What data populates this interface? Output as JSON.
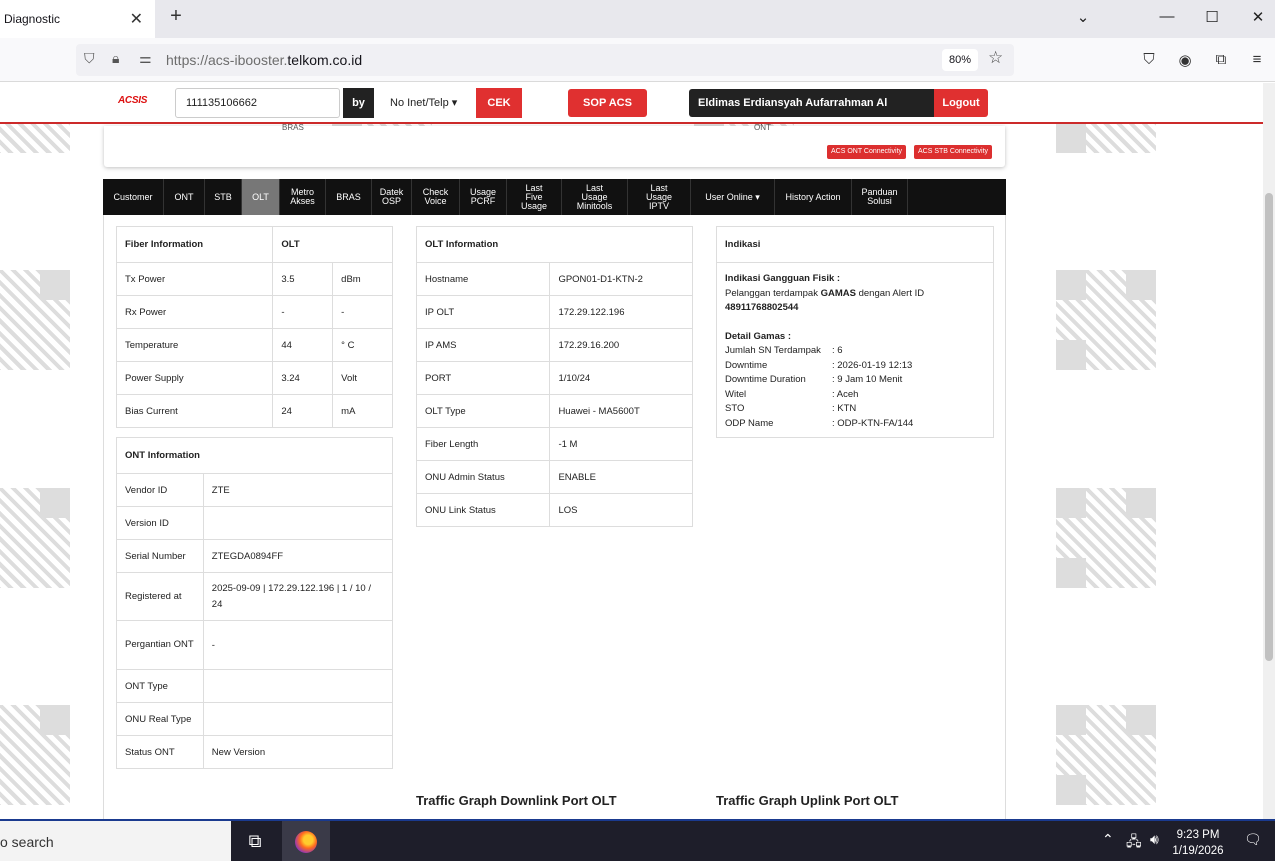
{
  "browser": {
    "tab_title": "Diagnostic",
    "url_prefix": "https://acs-ibooster.",
    "url_domain": "telkom.co.id",
    "zoom": "80%"
  },
  "header": {
    "logo": "ACSIS",
    "search_value": "111135106662",
    "by_label": "by",
    "select_value": "No Inet/Telp",
    "cek_label": "CEK",
    "sop_label": "SOP ACS",
    "user_name": "Eldimas Erdiansyah Aufarrahman Al Mubarok",
    "logout_label": "Logout",
    "cut_label_1": "BRAS",
    "cut_label_2": "ONT",
    "ont_conn_btn": "ACS ONT Connectivity",
    "stb_conn_btn": "ACS STB Connectivity"
  },
  "menu": [
    {
      "label": "Customer"
    },
    {
      "label": "ONT"
    },
    {
      "label": "STB"
    },
    {
      "label": "OLT",
      "active": true
    },
    {
      "label": "Metro Akses"
    },
    {
      "label": "BRAS"
    },
    {
      "label": "Datek OSP"
    },
    {
      "label": "Check Voice"
    },
    {
      "label": "Usage PCRF"
    },
    {
      "label": "Last Five Usage"
    },
    {
      "label": "Last Usage Minitools"
    },
    {
      "label": "Last Usage IPTV"
    },
    {
      "label": "User Online ▾"
    },
    {
      "label": "History Action"
    },
    {
      "label": "Panduan Solusi"
    }
  ],
  "fiber": {
    "header": [
      "Fiber Information",
      "OLT"
    ],
    "rows": [
      [
        "Tx Power",
        "3.5",
        "dBm"
      ],
      [
        "Rx Power",
        "-",
        "-"
      ],
      [
        "Temperature",
        "44",
        "° C"
      ],
      [
        "Power Supply",
        "3.24",
        "Volt"
      ],
      [
        "Bias Current",
        "24",
        "mA"
      ]
    ]
  },
  "ont": {
    "header": "ONT Information",
    "rows": [
      [
        "Vendor ID",
        "ZTE"
      ],
      [
        "Version ID",
        ""
      ],
      [
        "Serial Number",
        "ZTEGDA0894FF"
      ],
      [
        "Registered at",
        "2025-09-09 | 172.29.122.196 | 1 / 10 / 24"
      ],
      [
        "Pergantian ONT",
        "-"
      ],
      [
        "ONT Type",
        ""
      ],
      [
        "ONU Real Type",
        ""
      ],
      [
        "Status ONT",
        "New Version"
      ]
    ]
  },
  "olt": {
    "header": "OLT Information",
    "rows": [
      [
        "Hostname",
        "GPON01-D1-KTN-2"
      ],
      [
        "IP OLT",
        "172.29.122.196"
      ],
      [
        "IP AMS",
        "172.29.16.200"
      ],
      [
        "PORT",
        "1/10/24"
      ],
      [
        "OLT Type",
        "Huawei - MA5600T"
      ],
      [
        "Fiber Length",
        "-1 M"
      ],
      [
        "ONU Admin Status",
        "ENABLE"
      ],
      [
        "ONU Link Status",
        "LOS"
      ]
    ]
  },
  "indikasi": {
    "header": "Indikasi",
    "gangguan_title": "Indikasi Gangguan Fisik :",
    "gangguan_pre": "Pelanggan terdampak ",
    "gangguan_bold": "GAMAS",
    "gangguan_post": " dengan Alert ID",
    "alert_id": "48911768802544",
    "detail_title": "Detail Gamas :",
    "details": [
      [
        "Jumlah SN Terdampak",
        ": 6"
      ],
      [
        "Downtime",
        ": 2026-01-19 12:13"
      ],
      [
        "Downtime Duration",
        ": 9 Jam 10 Menit"
      ],
      [
        "Witel",
        ": Aceh"
      ],
      [
        "STO",
        ": KTN"
      ],
      [
        "ODP Name",
        ": ODP-KTN-FA/144"
      ]
    ]
  },
  "graphs": {
    "downlink": "Traffic Graph Downlink Port OLT",
    "uplink": "Traffic Graph Uplink Port OLT"
  },
  "taskbar": {
    "search": "o search",
    "time": "9:23 PM",
    "date": "1/19/2026"
  }
}
